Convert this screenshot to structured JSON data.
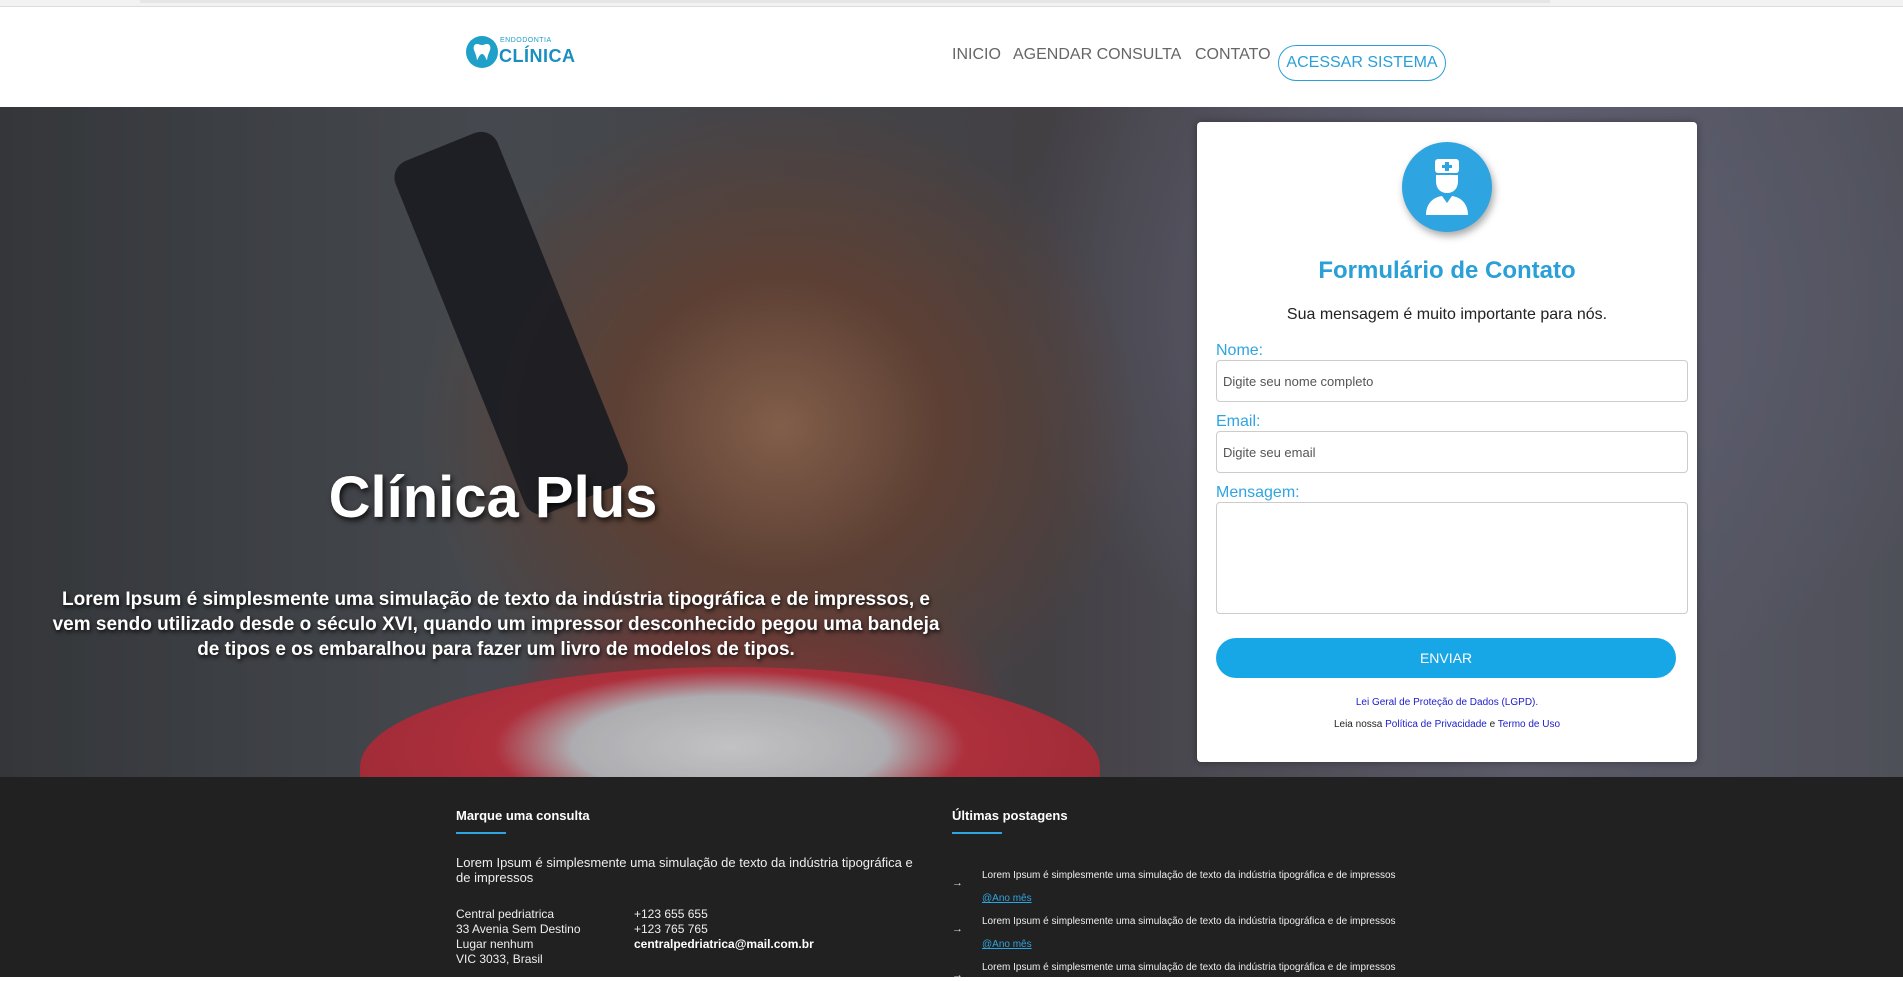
{
  "header": {
    "logo": {
      "small": "ENDODONTIA",
      "big": "CLÍNICA"
    },
    "nav": [
      {
        "label": "INICIO"
      },
      {
        "label": "AGENDAR CONSULTA"
      },
      {
        "label": "CONTATO"
      }
    ],
    "access_button": "ACESSAR SISTEMA"
  },
  "hero": {
    "title": "Clínica Plus",
    "text": "Lorem Ipsum é simplesmente uma simulação de texto da indústria tipográfica e de impressos, e vem sendo utilizado desde o século XVI, quando um impressor desconhecido pegou uma bandeja de tipos e os embaralhou para fazer um livro de modelos de tipos."
  },
  "form": {
    "title": "Formulário de Contato",
    "subtitle": "Sua mensagem é muito importante para nós.",
    "name_label": "Nome:",
    "name_placeholder": "Digite seu nome completo",
    "email_label": "Email:",
    "email_placeholder": "Digite seu email",
    "message_label": "Mensagem:",
    "message_value": "",
    "send_button": "ENVIAR",
    "lgpd_link": "Lei Geral de Proteção de Dados (LGPD).",
    "privacy_prefix": "Leia nossa",
    "privacy_link": "Política de Privacidade",
    "privacy_and": "e",
    "terms_link": "Termo de Uso"
  },
  "footer": {
    "col1": {
      "heading": "Marque uma consulta",
      "text": "Lorem Ipsum é simplesmente uma simulação de texto da indústria tipográfica e de impressos",
      "address": [
        "Central pedriatrica",
        "33 Avenia Sem Destino",
        "Lugar nenhum",
        "VIC 3033, Brasil"
      ],
      "phones": [
        "+123 655 655",
        "+123 765 765"
      ],
      "email": "centralpedriatrica@mail.com.br"
    },
    "col2": {
      "heading": "Últimas postagens",
      "posts": [
        {
          "text": "Lorem Ipsum é simplesmente uma simulação de texto da indústria tipográfica e de impressos",
          "date": "@Ano mês"
        },
        {
          "text": "Lorem Ipsum é simplesmente uma simulação de texto da indústria tipográfica e de impressos",
          "date": "@Ano mês"
        },
        {
          "text": "Lorem Ipsum é simplesmente uma simulação de texto da indústria tipográfica e de impressos",
          "date": ""
        }
      ]
    }
  },
  "colors": {
    "accent": "#2ea5e0",
    "footer_bg": "#212121",
    "send_button": "#17a6e6"
  },
  "icons": {
    "logo": "tooth-icon",
    "avatar": "doctor-icon",
    "post_bullet": "arrow-right-icon"
  }
}
